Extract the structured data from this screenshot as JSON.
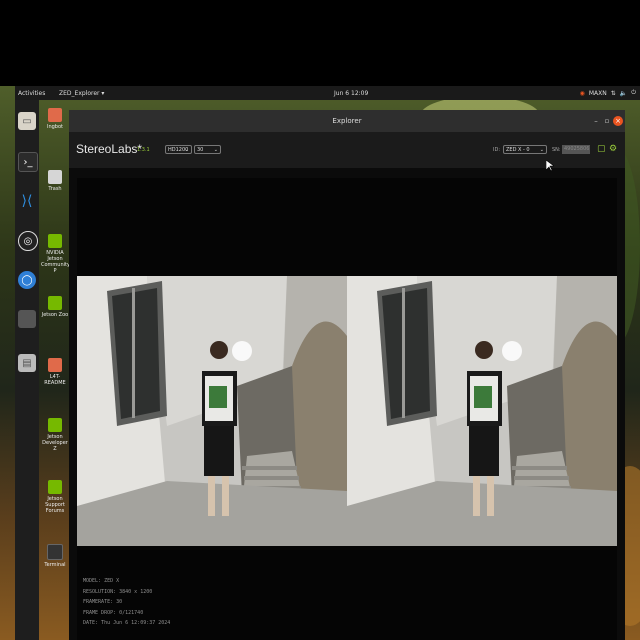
{
  "topbar": {
    "activities": "Activities",
    "app_menu": "ZED_Explorer ▾",
    "clock": "Jun 6 12:09",
    "maxn": "MAXN"
  },
  "dock": {
    "items": [
      "files-icon",
      "terminal-icon",
      "vscode-icon",
      "obs-icon",
      "chromium-icon",
      "app-icon",
      "disk-icon"
    ]
  },
  "desktop": {
    "icons": [
      "Ingbot",
      "Trash",
      "NVIDIA Jetson Community P",
      "Jetson Zoo",
      "L4T-README",
      "Jetson Developer Z",
      "Jetson Support Forums",
      "Terminal"
    ]
  },
  "window": {
    "title": "Explorer",
    "brand": "StereoLabs*",
    "version": "1.3.1",
    "resolution_select": "HD1200",
    "fps_select": "30",
    "id_label": "ID:",
    "id_select": "ZED X - 0",
    "sn_label": "SN:",
    "sn_value": "49025806"
  },
  "info": {
    "model": "MODEL: ZED X",
    "resolution": "RESOLUTION: 3840 x 1200",
    "framerate": "FRAMERATE: 30",
    "frame_drop": "FRAME DROP: 0/121740",
    "date": "DATE: Thu Jun 6 12:09:37 2024"
  },
  "colors": {
    "accent": "#9cd13b",
    "close": "#e95420"
  }
}
